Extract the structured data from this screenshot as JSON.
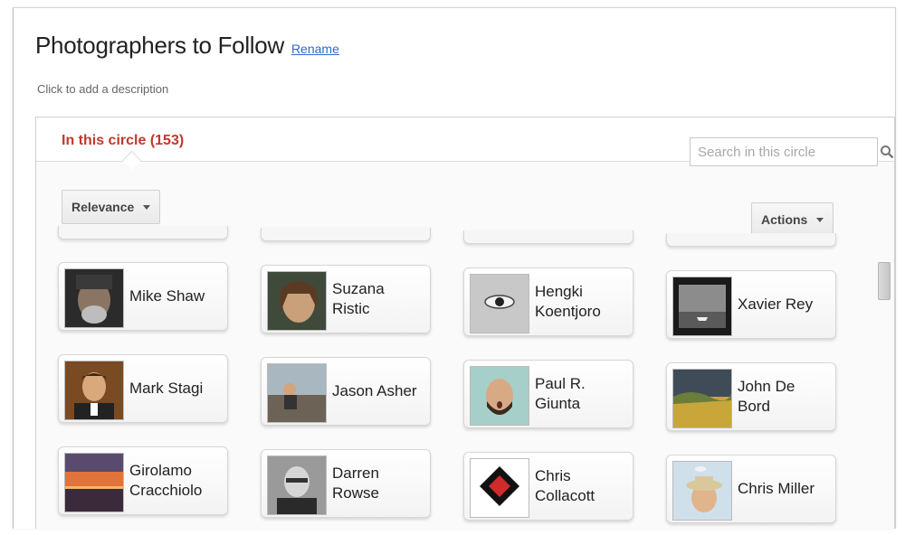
{
  "page": {
    "title": "Photographers to Follow",
    "rename_label": "Rename",
    "description_placeholder": "Click to add a description"
  },
  "circle": {
    "tab_label": "In this circle (153)",
    "search_placeholder": "Search in this circle",
    "sort_label": "Relevance",
    "actions_label": "Actions"
  },
  "people": [
    {
      "name": "Mike Shaw"
    },
    {
      "name": "Suzana Ristic"
    },
    {
      "name": "Hengki Koentjoro"
    },
    {
      "name": "Xavier Rey"
    },
    {
      "name": "Mark Stagi"
    },
    {
      "name": "Jason Asher"
    },
    {
      "name": "Paul R. Giunta"
    },
    {
      "name": "John De Bord"
    },
    {
      "name": "Girolamo Cracchiolo"
    },
    {
      "name": "Darren Rowse"
    },
    {
      "name": "Chris Collacott"
    },
    {
      "name": "Chris Miller"
    }
  ],
  "colors": {
    "accent_red": "#c0392b",
    "link_blue": "#3366cc"
  }
}
